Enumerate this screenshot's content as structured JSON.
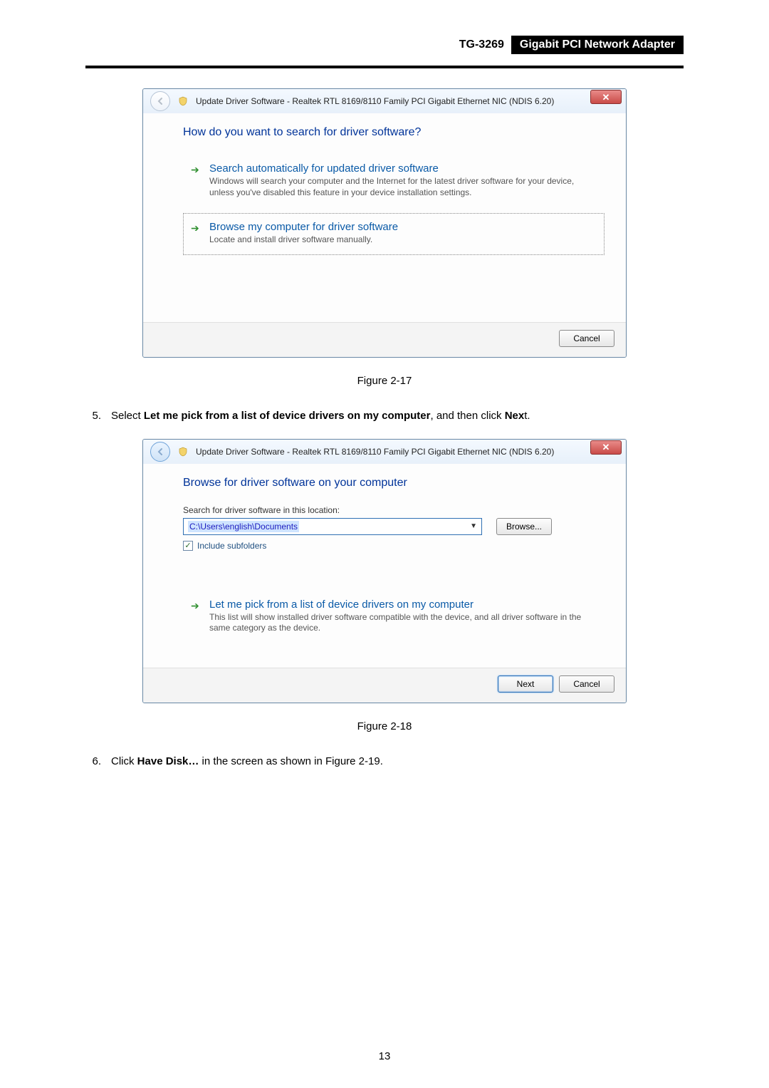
{
  "header": {
    "model": "TG-3269",
    "product": "Gigabit PCI Network Adapter"
  },
  "dialog1": {
    "title": "Update Driver Software -  Realtek RTL 8169/8110 Family PCI Gigabit Ethernet NIC (NDIS 6.20)",
    "prompt": "How do you want to search for driver software?",
    "option1": {
      "heading": "Search automatically for updated driver software",
      "desc": "Windows will search your computer and the Internet for the latest driver software for your device, unless you've disabled this feature in your device installation settings."
    },
    "option2": {
      "heading": "Browse my computer for driver software",
      "desc": "Locate and install driver software manually."
    },
    "cancel": "Cancel"
  },
  "caption1": "Figure 2-17",
  "step5": {
    "num": "5.",
    "before": "Select ",
    "bold": "Let me pick from a list of device drivers on my computer",
    "middle": ", and then click ",
    "bold2": "Nex",
    "after": "t."
  },
  "dialog2": {
    "title": "Update Driver Software -  Realtek RTL 8169/8110 Family PCI Gigabit Ethernet NIC (NDIS 6.20)",
    "prompt": "Browse for driver software on your computer",
    "search_label": "Search for driver software in this location:",
    "path": "C:\\Users\\english\\Documents",
    "browse": "Browse...",
    "include": "Include subfolders",
    "option1": {
      "heading": "Let me pick from a list of device drivers on my computer",
      "desc": "This list will show installed driver software compatible with the device, and all driver software in the same category as the device."
    },
    "next": "Next",
    "cancel": "Cancel"
  },
  "caption2": "Figure 2-18",
  "step6": {
    "num": "6.",
    "before": "Click ",
    "bold": "Have Disk…",
    "after": " in the screen as shown in Figure 2-19."
  },
  "page_number": "13"
}
